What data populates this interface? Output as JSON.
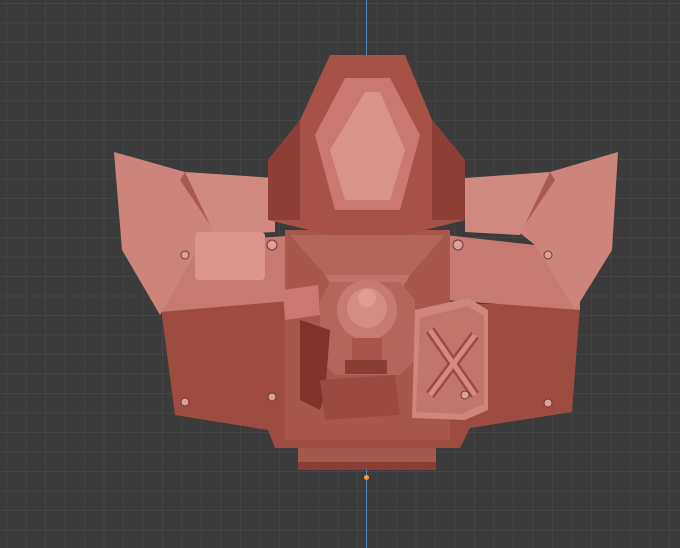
{
  "viewport": {
    "background": "#3b3b3b",
    "grid_color": "#454545",
    "axis_color": "#5a86c0",
    "origin_color": "#f0a030"
  },
  "model": {
    "base_color": "#c87a70",
    "light_color": "#d88b82",
    "dark_color": "#9c4a3f",
    "shadow_color": "#7a3429"
  }
}
